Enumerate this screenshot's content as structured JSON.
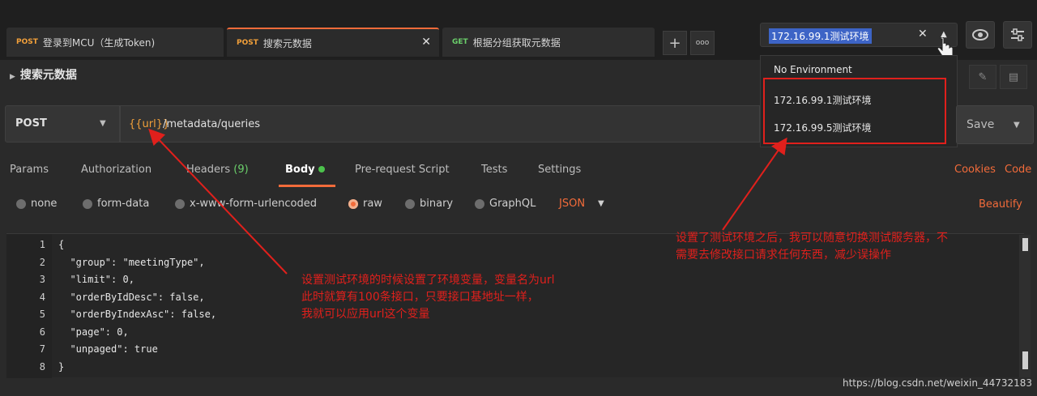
{
  "tabs": [
    {
      "method": "POST",
      "title": "登录到MCU（生成Token)",
      "active": false
    },
    {
      "method": "POST",
      "title": "搜索元数据",
      "active": true
    },
    {
      "method": "GET",
      "title": "根据分组获取元数据",
      "active": false
    }
  ],
  "tab_actions": {
    "add": "+",
    "more": "ooo"
  },
  "environment": {
    "selected": "172.16.99.1测试环境",
    "clear": "✕",
    "options": [
      "No Environment",
      "172.16.99.1测试环境",
      "172.16.99.5测试环境"
    ]
  },
  "request": {
    "name": "搜索元数据",
    "method": "POST",
    "url_variable": "{{url}}",
    "url_path": "/metadata/queries",
    "save_label": "Save"
  },
  "request_tabs": {
    "params": "Params",
    "authorization": "Authorization",
    "headers": "Headers",
    "headers_count": "(9)",
    "body": "Body",
    "prerequest": "Pre-request Script",
    "tests": "Tests",
    "settings": "Settings",
    "cookies": "Cookies",
    "code": "Code"
  },
  "body_types": {
    "none": "none",
    "form_data": "form-data",
    "urlencoded": "x-www-form-urlencoded",
    "raw": "raw",
    "binary": "binary",
    "graphql": "GraphQL",
    "format": "JSON",
    "beautify": "Beautify",
    "selected": "raw"
  },
  "editor": {
    "line_numbers": [
      "1",
      "2",
      "3",
      "4",
      "5",
      "6",
      "7",
      "8"
    ],
    "lines": [
      "{",
      "  \"group\": \"meetingType\",",
      "  \"limit\": 0,",
      "  \"orderByIdDesc\": false,",
      "  \"orderByIndexAsc\": false,",
      "  \"page\": 0,",
      "  \"unpaged\": true",
      "}"
    ]
  },
  "annotations": {
    "left_note": [
      "设置测试环境的时候设置了环境变量，变量名为url",
      "此时就算有100条接口，只要接口基地址一样，",
      "我就可以应用url这个变量"
    ],
    "right_note": [
      "设置了测试环境之后，我可以随意切换测试服务器，不",
      "需要去修改接口请求任何东西，减少误操作"
    ],
    "color": "#e0201c"
  },
  "watermark": "https://blog.csdn.net/weixin_44732183",
  "colors": {
    "accent": "#f26b3a",
    "post": "#f2a03a",
    "get": "#6bcf6b",
    "highlight": "#3d64c6"
  }
}
